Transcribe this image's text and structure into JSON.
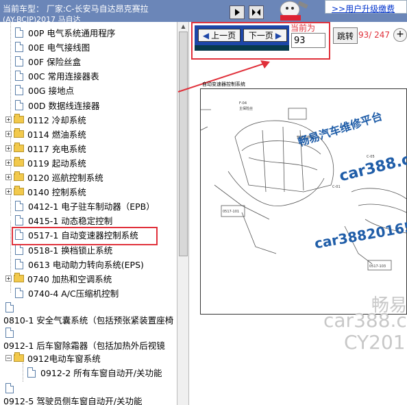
{
  "header": {
    "car_label": "当前车型：  厂家:C-长安马自达昂克赛拉",
    "car_sub_cut": "(AY-BCJP)2017 马自达",
    "upgrade_link": ">>用户升级缴费"
  },
  "tree": {
    "items": [
      {
        "label": "00P 电气系统通用程序"
      },
      {
        "label": "00E 电气接线图"
      },
      {
        "label": "00F 保险丝盒"
      },
      {
        "label": "00C 常用连接器表"
      },
      {
        "label": "00G 接地点"
      },
      {
        "label": "00D 数据线连接器"
      },
      {
        "label": "0112 冷却系统"
      },
      {
        "label": "0114 燃油系统"
      },
      {
        "label": "0117 充电系统"
      },
      {
        "label": "0119 起动系统"
      },
      {
        "label": "0120 巡航控制系统"
      },
      {
        "label": "0140 控制系统"
      },
      {
        "label": "0412-1 电子驻车制动器（EPB）"
      },
      {
        "label": "0415-1 动态稳定控制"
      },
      {
        "label": "0517-1 自动变速器控制系统"
      },
      {
        "label": "0518-1 换档锁止系统"
      },
      {
        "label": "0613 电动助力转向系统(EPS)"
      },
      {
        "label": "0740 加热和空调系统"
      },
      {
        "label": "0740-4 A/C压缩机控制"
      },
      {
        "label": "0810-1 安全气囊系统（包括预张紧装置座椅"
      },
      {
        "label": "0912-1 后车窗除霜器（包括加热外后视镜"
      },
      {
        "label": "0912电动车窗系统"
      },
      {
        "label": "0912-2 所有车窗自动开/关功能"
      },
      {
        "label": "0912-5 驾驶员侧车窗自动开/关功能"
      }
    ]
  },
  "nav": {
    "prev_label": "上一页",
    "next_label": "下一页",
    "current_label": "当前为",
    "current_value": "93",
    "jump_label": "跳转",
    "page_count": "93/ 247",
    "zoom_in": "+"
  },
  "diagram": {
    "title": "自动变速器控制系统"
  },
  "watermarks": {
    "w1": "畅易汽车维修平台",
    "w2": "car388.co",
    "w3": "car38820165",
    "w4": "畅易",
    "w5": "car388.co",
    "w6": "CY201"
  },
  "colors": {
    "topbar": "#6b86b8",
    "highlight_red": "#e0303a",
    "nav_blue": "#1d46a8",
    "watermark_blue": "#1f5da8"
  }
}
